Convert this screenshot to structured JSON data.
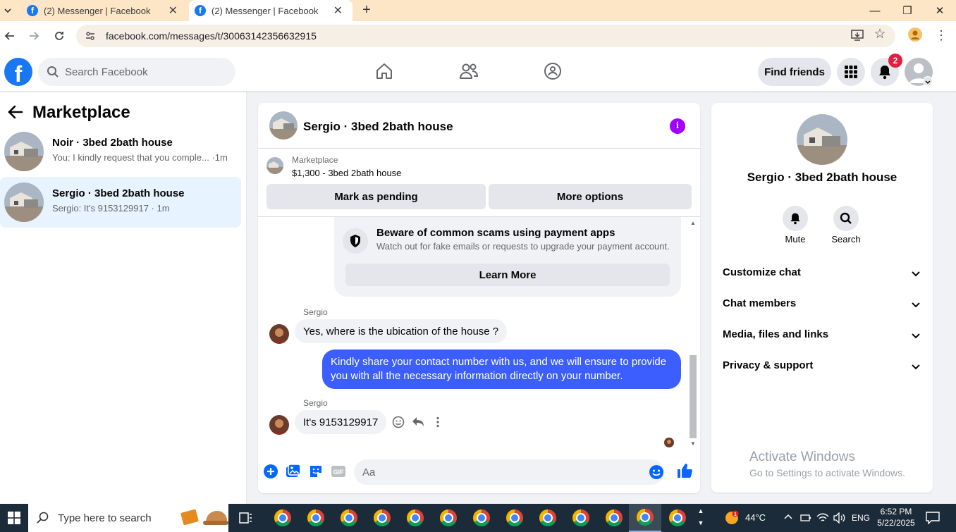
{
  "browser": {
    "tabs": [
      {
        "title": "(2) Messenger | Facebook",
        "active": false
      },
      {
        "title": "(2) Messenger | Facebook",
        "active": true
      }
    ],
    "url": "facebook.com/messages/t/30063142356632915"
  },
  "fb_header": {
    "logo": "f",
    "search_placeholder": "Search Facebook",
    "find_friends_label": "Find friends",
    "notification_count": "2"
  },
  "sidebar": {
    "title": "Marketplace",
    "conversations": [
      {
        "name": "Noir · 3bed 2bath house",
        "preview": "You: I kindly request that you comple... ·1m",
        "active": false
      },
      {
        "name": "Sergio · 3bed 2bath house",
        "preview": "Sergio: It's 9153129917 · 1m",
        "active": true
      }
    ]
  },
  "chat": {
    "title": "Sergio · 3bed 2bath house",
    "listing": {
      "source": "Marketplace",
      "price_title": "$1,300 - 3bed 2bath house",
      "mark_pending_label": "Mark as pending",
      "more_options_label": "More options"
    },
    "scam_warning": {
      "title": "Beware of common scams using payment apps",
      "subtitle": "Watch out for fake emails or requests to upgrade your payment account.",
      "button_label": "Learn More"
    },
    "messages": [
      {
        "sender": "Sergio",
        "direction": "in",
        "text": "Yes,  where is the ubication of the house ?"
      },
      {
        "sender": "",
        "direction": "out",
        "text": "Kindly share your contact number with us, and we will ensure to provide you with all the necessary information directly on your number."
      },
      {
        "sender": "Sergio",
        "direction": "in",
        "text": "It's 9153129917"
      }
    ],
    "composer_placeholder": "Aa"
  },
  "right_panel": {
    "name": "Sergio · 3bed 2bath house",
    "actions": [
      {
        "label": "Mute",
        "icon": "bell-icon"
      },
      {
        "label": "Search",
        "icon": "search-icon"
      }
    ],
    "sections": [
      "Customize chat",
      "Chat members",
      "Media, files and links",
      "Privacy & support"
    ]
  },
  "watermark": {
    "line1": "Activate Windows",
    "line2": "Go to Settings to activate Windows."
  },
  "taskbar": {
    "search_placeholder": "Type here to search",
    "temperature": "44°C",
    "language": "ENG",
    "time": "6:52 PM",
    "date": "5/22/2025"
  },
  "colors": {
    "facebook_blue": "#1877f2",
    "outgoing_bubble": "#3c5efe",
    "info_purple": "#a100ff",
    "active_conversation": "#e7f3ff"
  }
}
